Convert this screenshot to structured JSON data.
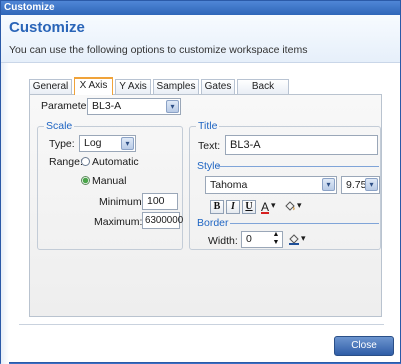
{
  "window": {
    "title": "Customize"
  },
  "header": {
    "title": "Customize",
    "subtitle": "You can use the following options to customize workspace items"
  },
  "tabs": [
    {
      "label": "General"
    },
    {
      "label": "X Axis",
      "active": true
    },
    {
      "label": "Y Axis"
    },
    {
      "label": "Samples"
    },
    {
      "label": "Gates"
    },
    {
      "label": "Back Gates"
    }
  ],
  "parameter": {
    "label": "Parameter:",
    "value": "BL3-A"
  },
  "scale": {
    "legend": "Scale",
    "type_label": "Type:",
    "type_value": "Log",
    "range_label": "Range:",
    "automatic_label": "Automatic",
    "manual_label": "Manual",
    "selected_range": "Manual",
    "minimum_label": "Minimum:",
    "minimum_value": "100",
    "maximum_label": "Maximum:",
    "maximum_value": "6300000"
  },
  "title_group": {
    "legend": "Title",
    "text_label": "Text:",
    "text_value": "BL3-A",
    "style_label": "Style",
    "font_value": "Tahoma",
    "font_size_value": "9.75",
    "bold_label": "B",
    "italic_label": "I",
    "underline_label": "U",
    "font_color_glyph": "A",
    "dropdown_glyph": "▾",
    "border_label": "Border",
    "width_label": "Width:",
    "width_value": "0"
  },
  "footer": {
    "close_label": "Close"
  },
  "colors": {
    "accent": "#1f65c3",
    "title_bar": "#2f66b9",
    "active_tab": "#f0a33a"
  }
}
